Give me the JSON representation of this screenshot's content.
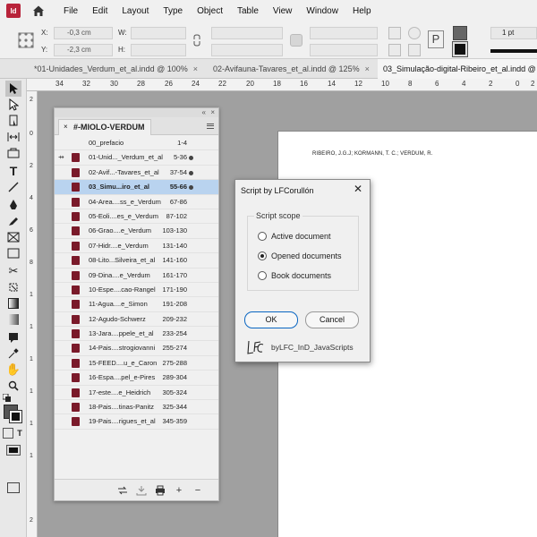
{
  "app": {
    "logo_text": "Id"
  },
  "menubar": {
    "items": [
      "File",
      "Edit",
      "Layout",
      "Type",
      "Object",
      "Table",
      "View",
      "Window",
      "Help"
    ]
  },
  "controlbar": {
    "x_label": "X:",
    "x_value": "-0,3 cm",
    "y_label": "Y:",
    "y_value": "-2,3 cm",
    "w_label": "W:",
    "h_label": "H:",
    "stroke_weight": "1 pt"
  },
  "tabs": [
    {
      "label": "*01-Unidades_Verdum_et_al.indd @ 100%",
      "active": false
    },
    {
      "label": "02-Avifauna-Tavares_et_al.indd @ 125%",
      "active": false
    },
    {
      "label": "03_Simulação-digital-Ribeiro_et_al.indd @ 68",
      "active": true
    }
  ],
  "rulers": {
    "top": [
      "34",
      "32",
      "30",
      "28",
      "26",
      "24",
      "22",
      "20",
      "18",
      "16",
      "14",
      "12",
      "10",
      "8",
      "6",
      "4",
      "2",
      "0",
      "2"
    ],
    "left": [
      "2",
      "0",
      "2",
      "4",
      "6",
      "8",
      "1",
      "1",
      "1",
      "1",
      "1",
      "1",
      "2"
    ]
  },
  "page": {
    "running_head": "RIBEIRO, J.G.J; KORMANN, T. C.; VERDUM, R."
  },
  "book_panel": {
    "collapse_icon": "«",
    "close_icon": "×",
    "title": "#-MIOLO-VERDUM",
    "rows": [
      {
        "name": "00_prefacio",
        "pages": "1-4",
        "has_doc_icon": false,
        "status": false,
        "selected": false,
        "sync": ""
      },
      {
        "name": "01-Unid..._Verdum_et_al",
        "pages": "5-36",
        "has_doc_icon": true,
        "status": true,
        "selected": false,
        "sync": "⇸"
      },
      {
        "name": "02-Avif...-Tavares_et_al",
        "pages": "37-54",
        "has_doc_icon": true,
        "status": true,
        "selected": false,
        "sync": ""
      },
      {
        "name": "03_Simu...iro_et_al",
        "pages": "55-66",
        "has_doc_icon": true,
        "status": true,
        "selected": true,
        "sync": ""
      },
      {
        "name": "04-Area....ss_e_Verdum",
        "pages": "67-86",
        "has_doc_icon": true,
        "status": false,
        "selected": false,
        "sync": ""
      },
      {
        "name": "05-Eoli....es_e_Verdum",
        "pages": "87-102",
        "has_doc_icon": true,
        "status": false,
        "selected": false,
        "sync": ""
      },
      {
        "name": "06-Grao....e_Verdum",
        "pages": "103-130",
        "has_doc_icon": true,
        "status": false,
        "selected": false,
        "sync": ""
      },
      {
        "name": "07-Hidr....e_Verdum",
        "pages": "131-140",
        "has_doc_icon": true,
        "status": false,
        "selected": false,
        "sync": ""
      },
      {
        "name": "08-Lito...Silveira_et_al",
        "pages": "141-160",
        "has_doc_icon": true,
        "status": false,
        "selected": false,
        "sync": ""
      },
      {
        "name": "09-Dina....e_Verdum",
        "pages": "161-170",
        "has_doc_icon": true,
        "status": false,
        "selected": false,
        "sync": ""
      },
      {
        "name": "10-Espe....cao-Rangel",
        "pages": "171-190",
        "has_doc_icon": true,
        "status": false,
        "selected": false,
        "sync": ""
      },
      {
        "name": "11-Agua....e_Simon",
        "pages": "191-208",
        "has_doc_icon": true,
        "status": false,
        "selected": false,
        "sync": ""
      },
      {
        "name": "12-Agudo-Schwerz",
        "pages": "209-232",
        "has_doc_icon": true,
        "status": false,
        "selected": false,
        "sync": ""
      },
      {
        "name": "13-Jara....ppele_et_al",
        "pages": "233-254",
        "has_doc_icon": true,
        "status": false,
        "selected": false,
        "sync": ""
      },
      {
        "name": "14-Pais....strogiovanni",
        "pages": "255-274",
        "has_doc_icon": true,
        "status": false,
        "selected": false,
        "sync": ""
      },
      {
        "name": "15-FEED....u_e_Caron",
        "pages": "275-288",
        "has_doc_icon": true,
        "status": false,
        "selected": false,
        "sync": ""
      },
      {
        "name": "16-Espa....pel_e-Pires",
        "pages": "289-304",
        "has_doc_icon": true,
        "status": false,
        "selected": false,
        "sync": ""
      },
      {
        "name": "17-este....e_Heidrich",
        "pages": "305-324",
        "has_doc_icon": true,
        "status": false,
        "selected": false,
        "sync": ""
      },
      {
        "name": "18-Pais....tinas-Panitz",
        "pages": "325-344",
        "has_doc_icon": true,
        "status": false,
        "selected": false,
        "sync": ""
      },
      {
        "name": "19-Pais....rigues_et_al",
        "pages": "345-359",
        "has_doc_icon": true,
        "status": false,
        "selected": false,
        "sync": ""
      }
    ],
    "footer_icons": [
      "sync-styles-icon",
      "save-book-icon",
      "print-book-icon",
      "add-document-icon",
      "remove-document-icon"
    ]
  },
  "dialog": {
    "title": "Script by LFCorullón",
    "close": "✕",
    "group_label": "Script scope",
    "options": [
      {
        "label": "Active document",
        "checked": false
      },
      {
        "label": "Opened documents",
        "checked": true
      },
      {
        "label": "Book documents",
        "checked": false
      }
    ],
    "ok_label": "OK",
    "cancel_label": "Cancel",
    "brand_label": "byLFC_InD_JavaScripts"
  },
  "colors": {
    "accent": "#0a66c2",
    "app_brand": "#b8233a",
    "selection": "#b9d3ef"
  }
}
